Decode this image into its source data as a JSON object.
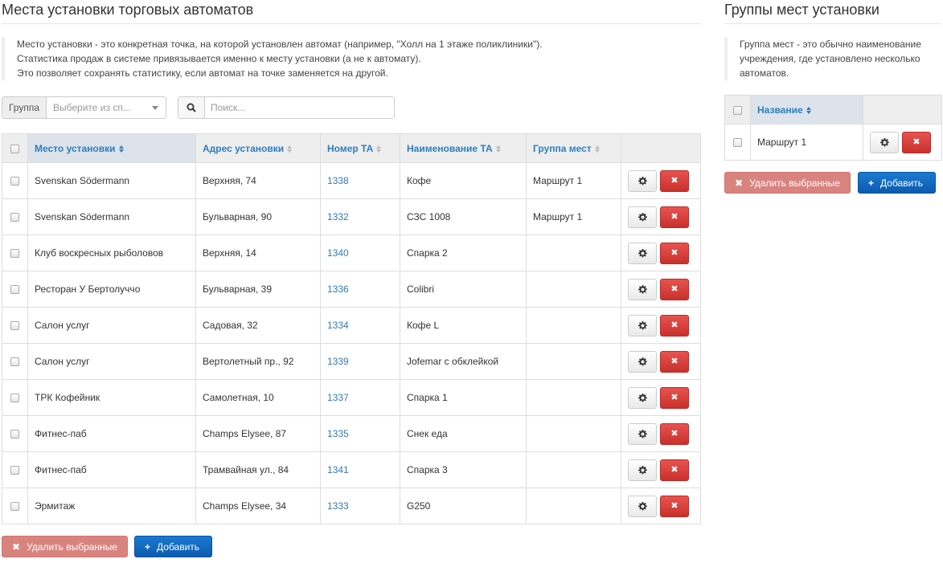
{
  "left": {
    "title": "Места установки торговых автоматов",
    "info": [
      "Место установки - это конкретная точка, на которой установлен автомат (например, \"Холл на 1 этаже поликлиники\").",
      "Статистика продаж в системе привязывается именно к месту установки (а не к автомату).",
      "Это позволяет сохранять статистику, если автомат на точке заменяется на другой."
    ],
    "filter": {
      "group_label": "Группа",
      "group_placeholder": "Выберите из сп...",
      "search_placeholder": "Поиск..."
    },
    "columns": [
      "Место установки",
      "Адрес установки",
      "Номер ТА",
      "Наименование ТА",
      "Группа мест"
    ],
    "rows": [
      {
        "place": "Svenskan Södermann",
        "address": "Верхняя, 74",
        "number": "1338",
        "name": "Кофе",
        "group": "Маршрут 1"
      },
      {
        "place": "Svenskan Södermann",
        "address": "Бульварная, 90",
        "number": "1332",
        "name": "СЗС 1008",
        "group": "Маршрут 1"
      },
      {
        "place": "Клуб воскресных рыболовов",
        "address": "Верхняя, 14",
        "number": "1340",
        "name": "Спарка 2",
        "group": ""
      },
      {
        "place": "Ресторан У Бертолуччо",
        "address": "Бульварная, 39",
        "number": "1336",
        "name": "Colibri",
        "group": ""
      },
      {
        "place": "Салон услуг",
        "address": "Садовая, 32",
        "number": "1334",
        "name": "Кофе L",
        "group": ""
      },
      {
        "place": "Салон услуг",
        "address": "Вертолетный пр., 92",
        "number": "1339",
        "name": "Jofemar с обклейкой",
        "group": ""
      },
      {
        "place": "ТРК Кофейник",
        "address": "Самолетная, 10",
        "number": "1337",
        "name": "Спарка 1",
        "group": ""
      },
      {
        "place": "Фитнес-паб",
        "address": "Champs Elysee, 87",
        "number": "1335",
        "name": "Снек еда",
        "group": ""
      },
      {
        "place": "Фитнес-паб",
        "address": "Трамвайная ул., 84",
        "number": "1341",
        "name": "Спарка 3",
        "group": ""
      },
      {
        "place": "Эрмитаж",
        "address": "Champs Elysee, 34",
        "number": "1333",
        "name": "G250",
        "group": ""
      }
    ],
    "delete_selected": "Удалить выбранные",
    "add": "Добавить"
  },
  "right": {
    "title": "Группы мест установки",
    "info": [
      "Группа мест - это обычно наименование",
      "учреждения, где установлено несколько",
      "автоматов."
    ],
    "column": "Название",
    "rows": [
      {
        "name": "Маршрут 1"
      }
    ],
    "delete_selected": "Удалить выбранные",
    "add": "Добавить"
  },
  "icons": {
    "search": "search-icon",
    "gear": "gear-icon",
    "delete": "close-icon",
    "plus": "plus-icon",
    "sort": "sort-icon"
  },
  "colors": {
    "link": "#337ab7",
    "danger": "#c9302c",
    "primary": "#0c5bb0"
  }
}
